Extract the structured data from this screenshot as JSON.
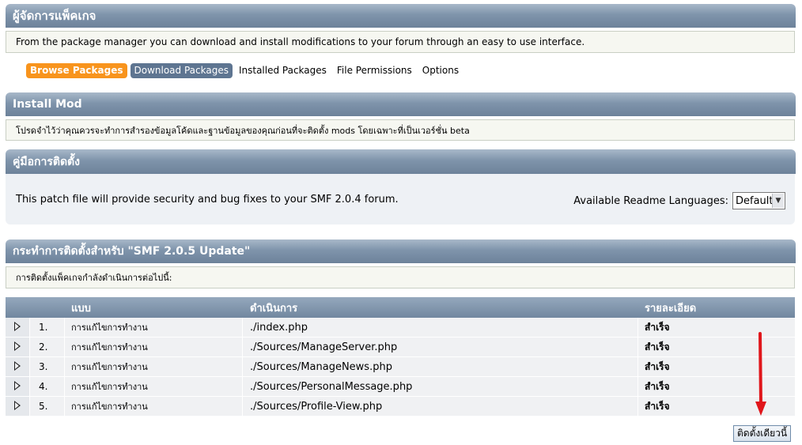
{
  "header": {
    "title": "ผู้จัดการแพ็คเกจ"
  },
  "intro": {
    "text": "From the package manager you can download and install modifications to your forum through an easy to use interface."
  },
  "tabs": [
    {
      "label": "Browse Packages",
      "state": "active"
    },
    {
      "label": "Download Packages",
      "state": "selected"
    },
    {
      "label": "Installed Packages",
      "state": "normal"
    },
    {
      "label": "File Permissions",
      "state": "normal"
    },
    {
      "label": "Options",
      "state": "normal"
    }
  ],
  "install_mod": {
    "title": "Install Mod",
    "notice": "โปรดจำไว้ว่าคุณควรจะทำการสำรองข้อมูลโค้ดและฐานข้อมูลของคุณก่อนที่จะติดตั้ง mods โดยเฉพาะที่เป็นเวอร์ชั่น beta"
  },
  "readme": {
    "title": "คู่มือการติดตั้ง",
    "text": "This patch file will provide security and bug fixes to your SMF 2.0.4 forum.",
    "languages_label": "Available Readme Languages:",
    "language_selected": "Default"
  },
  "actions": {
    "title": "กระทำการติดตั้งสำหรับ \"SMF 2.0.5 Update\"",
    "subtitle": "การติดตั้งแพ็คเกจกำลังดำเนินการต่อไปนี้:",
    "columns": [
      "แบบ",
      "ดำเนินการ",
      "รายละเอียด"
    ],
    "rows": [
      {
        "num": "1.",
        "type": "การแก้ไขการทำงาน",
        "action": "./index.php",
        "status": "สำเร็จ"
      },
      {
        "num": "2.",
        "type": "การแก้ไขการทำงาน",
        "action": "./Sources/ManageServer.php",
        "status": "สำเร็จ"
      },
      {
        "num": "3.",
        "type": "การแก้ไขการทำงาน",
        "action": "./Sources/ManageNews.php",
        "status": "สำเร็จ"
      },
      {
        "num": "4.",
        "type": "การแก้ไขการทำงาน",
        "action": "./Sources/PersonalMessage.php",
        "status": "สำเร็จ"
      },
      {
        "num": "5.",
        "type": "การแก้ไขการทำงาน",
        "action": "./Sources/Profile-View.php",
        "status": "สำเร็จ"
      }
    ],
    "install_button": "ติดตั้งเดียวนี้"
  },
  "colors": {
    "tab_active": "#f8941d",
    "tab_selected": "#5e7591",
    "annotation_arrow": "#e0161b"
  },
  "icons": {
    "row_expand": "triangle-right-icon",
    "select_arrow": "chevron-down-icon"
  }
}
